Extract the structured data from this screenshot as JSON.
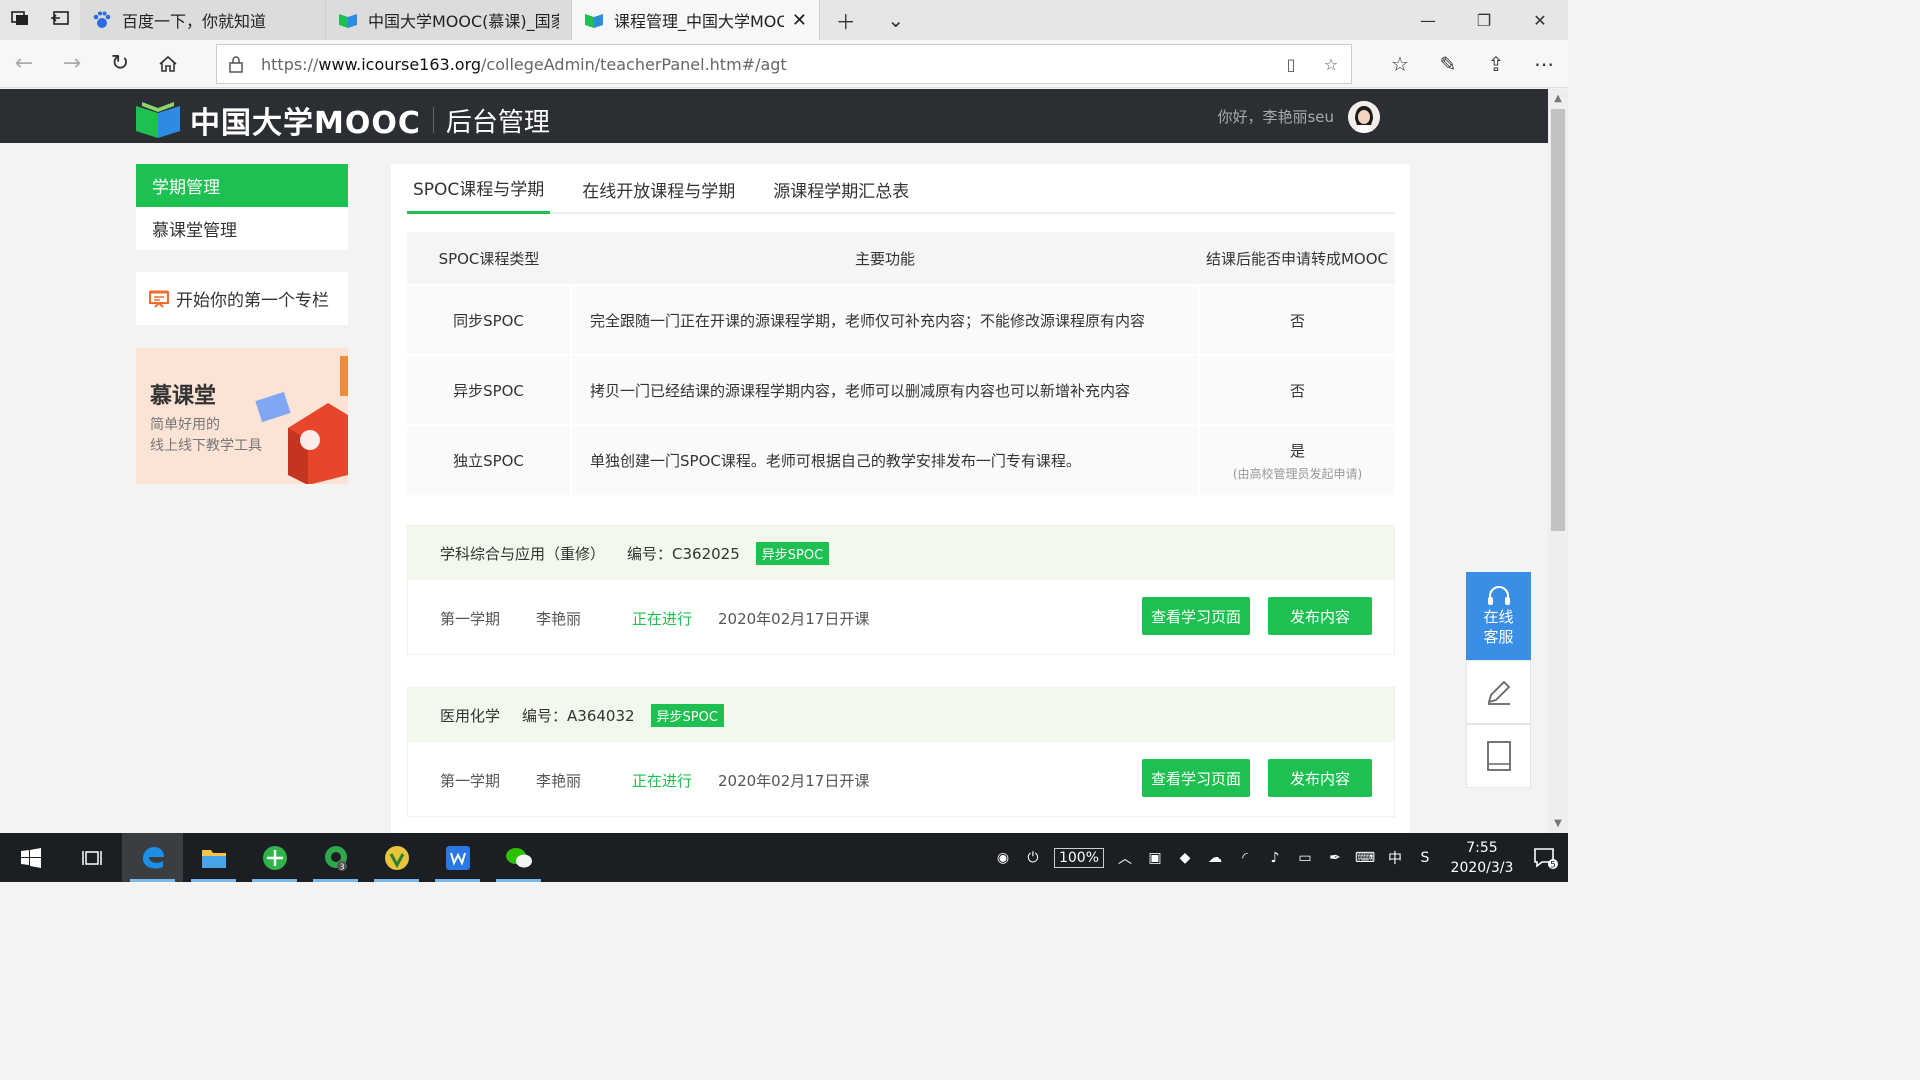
{
  "browser": {
    "tabs": [
      {
        "label": "百度一下，你就知道",
        "active": false
      },
      {
        "label": "中国大学MOOC(慕课)_国家",
        "active": false
      },
      {
        "label": "课程管理_中国大学MOOC",
        "active": true
      }
    ],
    "url_prefix": "https://",
    "url_host": "www.icourse163.org",
    "url_path": "/collegeAdmin/teacherPanel.htm#/agt"
  },
  "header": {
    "logo_text": "中国大学MOOC",
    "section_title": "后台管理",
    "greeting": "你好，李艳丽seu"
  },
  "sidebar": {
    "items": [
      {
        "label": "学期管理",
        "active": true
      },
      {
        "label": "慕课堂管理",
        "active": false
      }
    ],
    "zhuanlan": "开始你的第一个专栏",
    "promo": {
      "title": "慕课堂",
      "line1": "简单好用的",
      "line2": "线上线下教学工具"
    }
  },
  "main": {
    "tabs": [
      {
        "label": "SPOC课程与学期",
        "active": true
      },
      {
        "label": "在线开放课程与学期",
        "active": false
      },
      {
        "label": "源课程学期汇总表",
        "active": false
      }
    ],
    "intro_table": {
      "headers": [
        "SPOC课程类型",
        "主要功能",
        "结课后能否申请转成MOOC"
      ],
      "rows": [
        {
          "type": "同步SPOC",
          "desc": "完全跟随一门正在开课的源课程学期，老师仅可补充内容；不能修改源课程原有内容",
          "convert": "否",
          "note": ""
        },
        {
          "type": "异步SPOC",
          "desc": "拷贝一门已经结课的源课程学期内容，老师可以删减原有内容也可以新增补充内容",
          "convert": "否",
          "note": ""
        },
        {
          "type": "独立SPOC",
          "desc": "单独创建一门SPOC课程。老师可根据自己的教学安排发布一门专有课程。",
          "convert": "是",
          "note": "(由高校管理员发起申请)"
        }
      ]
    },
    "courses": [
      {
        "name": "学科综合与应用（重修）",
        "code": "编号：C362025",
        "tag": "异步SPOC",
        "term": "第一学期",
        "teacher": "李艳丽",
        "status": "正在进行",
        "start": "2020年02月17日开课",
        "btn_view": "查看学习页面",
        "btn_publish": "发布内容"
      },
      {
        "name": "医用化学",
        "code": "编号：A364032",
        "tag": "异步SPOC",
        "term": "第一学期",
        "teacher": "李艳丽",
        "status": "正在进行",
        "start": "2020年02月17日开课",
        "btn_view": "查看学习页面",
        "btn_publish": "发布内容"
      }
    ]
  },
  "float_widget": {
    "service_line1": "在线",
    "service_line2": "客服"
  },
  "taskbar": {
    "battery": "100%",
    "ime": "中",
    "time": "7:55",
    "date": "2020/3/3",
    "badge_wechat": "3",
    "notif_count": "5"
  },
  "colors": {
    "brand_green": "#1ec151",
    "header_dark": "#2b2f33",
    "service_blue": "#3a8ee6",
    "course_head_bg": "#f2f9ec"
  }
}
